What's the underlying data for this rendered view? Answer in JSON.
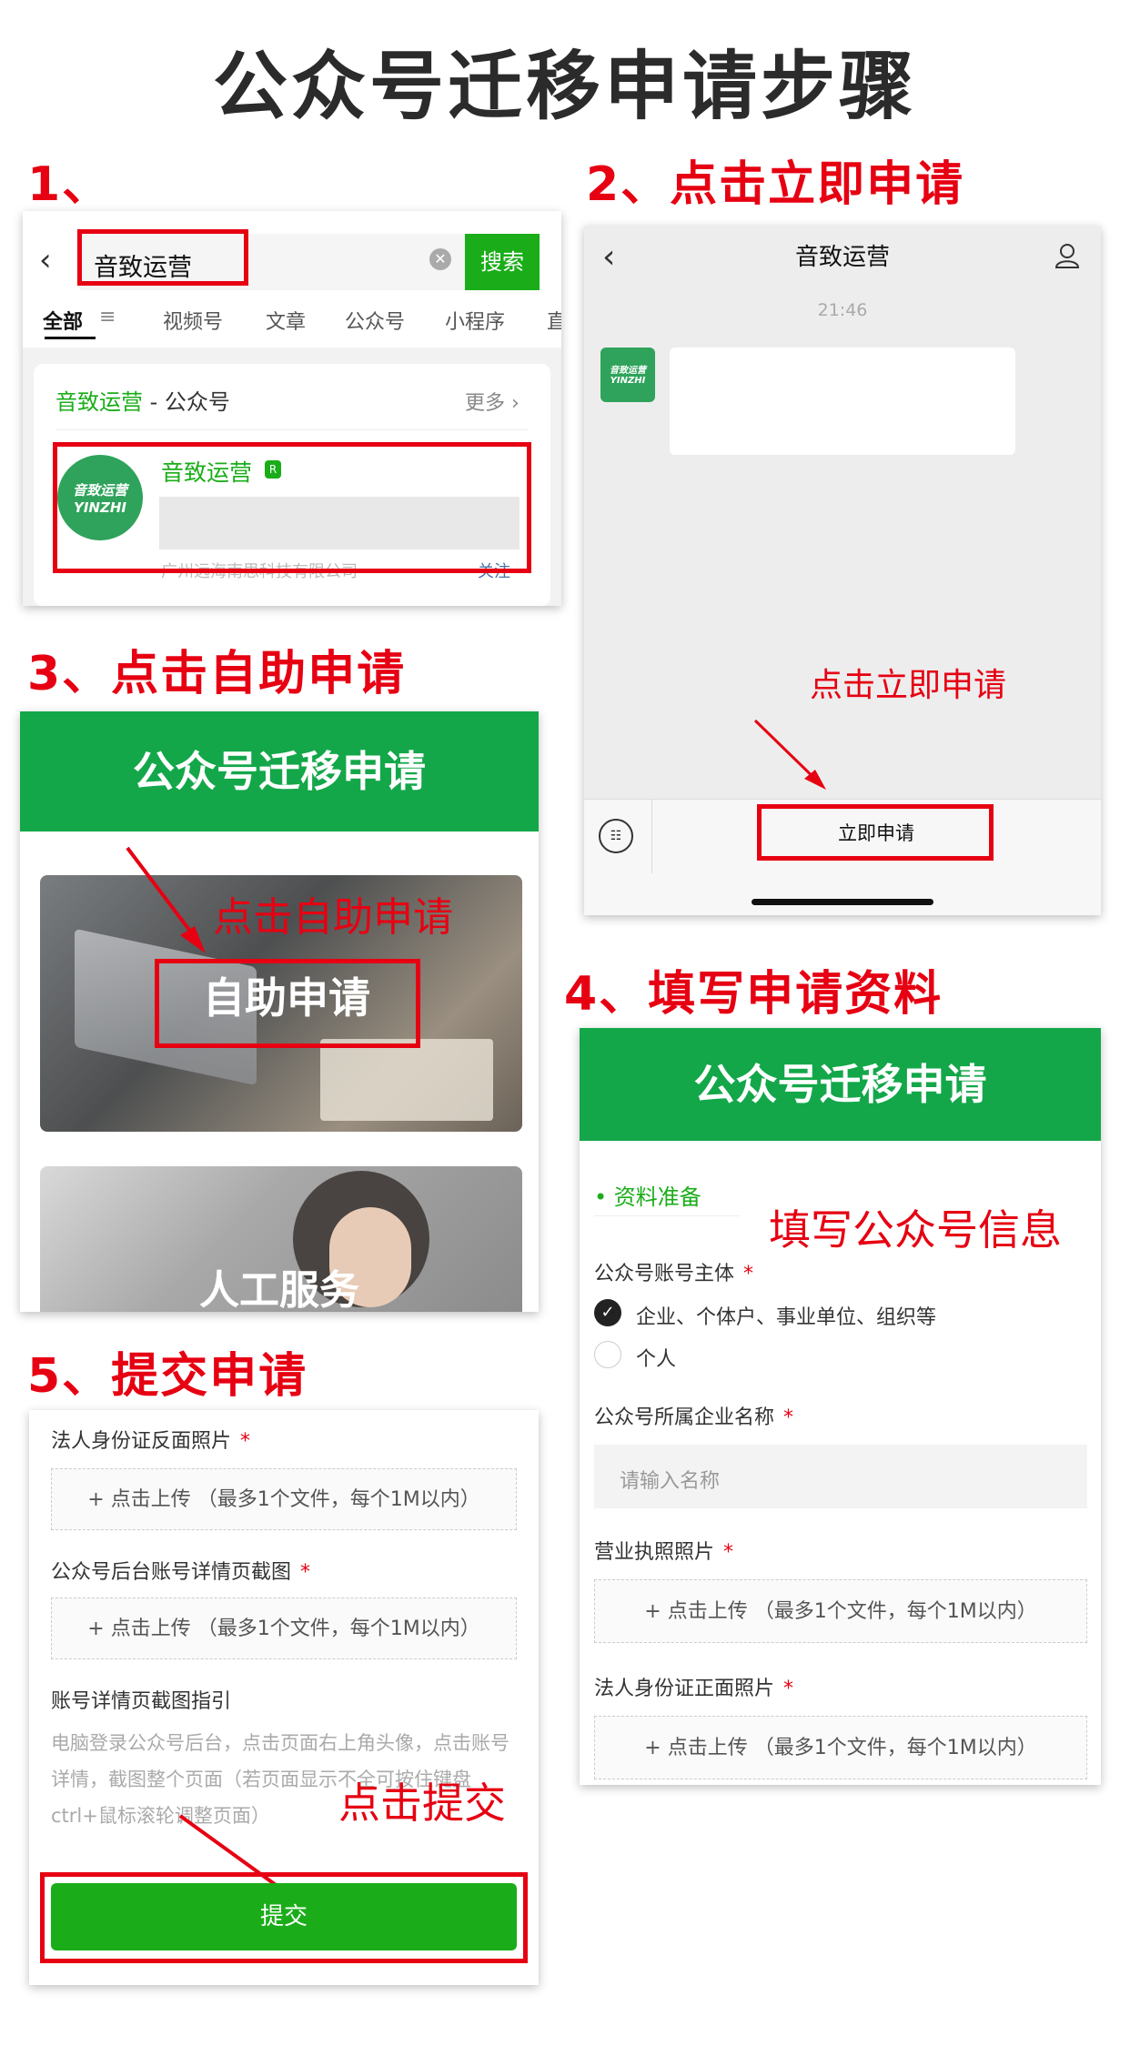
{
  "page_title": "公众号迁移申请步骤",
  "steps": {
    "s1": "1、",
    "s2": "2、点击立即申请",
    "s3": "3、点击自助申请",
    "s4": "4、填写申请资料",
    "s5": "5、提交申请"
  },
  "panel1": {
    "search_value": "音致运营",
    "search_button": "搜索",
    "tabs": [
      "全部",
      "视频号",
      "文章",
      "公众号",
      "小程序",
      "直"
    ],
    "section_name": "音致运营",
    "section_suffix": "- 公众号",
    "more": "更多",
    "result_name": "音致运营",
    "avatar_text_top": "音致运营",
    "avatar_text_bottom": "YINZHI",
    "result_company": "广州远海南思科技有限公司",
    "follow": "关注"
  },
  "panel2": {
    "chat_title": "音致运营",
    "time": "21:46",
    "avatar_text_top": "音致运营",
    "avatar_text_bottom": "YINZHI",
    "annotation": "点击立即申请",
    "apply_button": "立即申请"
  },
  "panel3": {
    "header": "公众号迁移申请",
    "annotation": "点击自助申请",
    "self_service": "自助申请",
    "manual_service": "人工服务"
  },
  "panel4": {
    "header": "公众号迁移申请",
    "section": "资料准备",
    "annotation": "填写公众号信息",
    "subject_label": "公众号账号主体",
    "option1": "企业、个体户、事业单位、组织等",
    "option2": "个人",
    "company_label": "公众号所属企业名称",
    "company_placeholder": "请输入名称",
    "license_label": "营业执照照片",
    "upload_text": "+ 点击上传 （最多1个文件，每个1M以内）",
    "id_front_label": "法人身份证正面照片",
    "required_mark": "*"
  },
  "panel5": {
    "id_back_label": "法人身份证反面照片",
    "upload_text": "+ 点击上传 （最多1个文件，每个1M以内）",
    "screenshot_label": "公众号后台账号详情页截图",
    "guide_title": "账号详情页截图指引",
    "guide_text": "电脑登录公众号后台，点击页面右上角头像，点击账号详情，截图整个页面（若页面显示不全可按住键盘ctrl+鼠标滚轮调整页面）",
    "annotation": "点击提交",
    "submit": "提交",
    "required_mark": "*"
  },
  "colors": {
    "accent_red": "#e60012",
    "wechat_green": "#1aad19",
    "header_green": "#13a74a"
  }
}
